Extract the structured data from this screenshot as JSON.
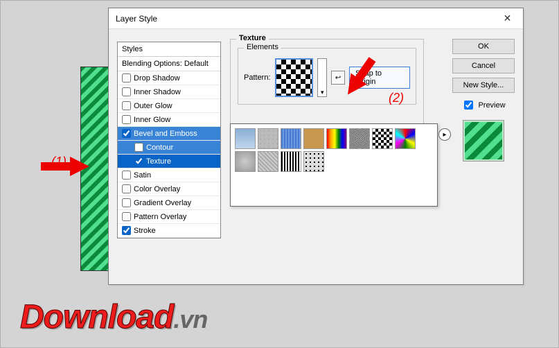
{
  "annotations": {
    "label1": "(1)",
    "label2": "(2)"
  },
  "logo": {
    "main": "Download",
    "tld": ".vn"
  },
  "dialog": {
    "title": "Layer Style",
    "close": "✕",
    "styles": {
      "header": "Styles",
      "blending": "Blending Options: Default",
      "items": [
        {
          "label": "Drop Shadow",
          "checked": false
        },
        {
          "label": "Inner Shadow",
          "checked": false
        },
        {
          "label": "Outer Glow",
          "checked": false
        },
        {
          "label": "Inner Glow",
          "checked": false
        },
        {
          "label": "Bevel and Emboss",
          "checked": true,
          "selected": "light"
        },
        {
          "label": "Contour",
          "checked": false,
          "indent": true,
          "selected": "light"
        },
        {
          "label": "Texture",
          "checked": true,
          "indent": true,
          "selected": "strong"
        },
        {
          "label": "Satin",
          "checked": false
        },
        {
          "label": "Color Overlay",
          "checked": false
        },
        {
          "label": "Gradient Overlay",
          "checked": false
        },
        {
          "label": "Pattern Overlay",
          "checked": false
        },
        {
          "label": "Stroke",
          "checked": true
        }
      ]
    },
    "texture": {
      "group_label": "Texture",
      "elements_label": "Elements",
      "pattern_label": "Pattern:",
      "dropdown_glyph": "▾",
      "swap_glyph": "↩",
      "snap_btn": "Snap to Origin"
    },
    "popup": {
      "flyout": "▸"
    },
    "right": {
      "ok": "OK",
      "cancel": "Cancel",
      "newstyle": "New Style...",
      "preview": "Preview"
    }
  }
}
